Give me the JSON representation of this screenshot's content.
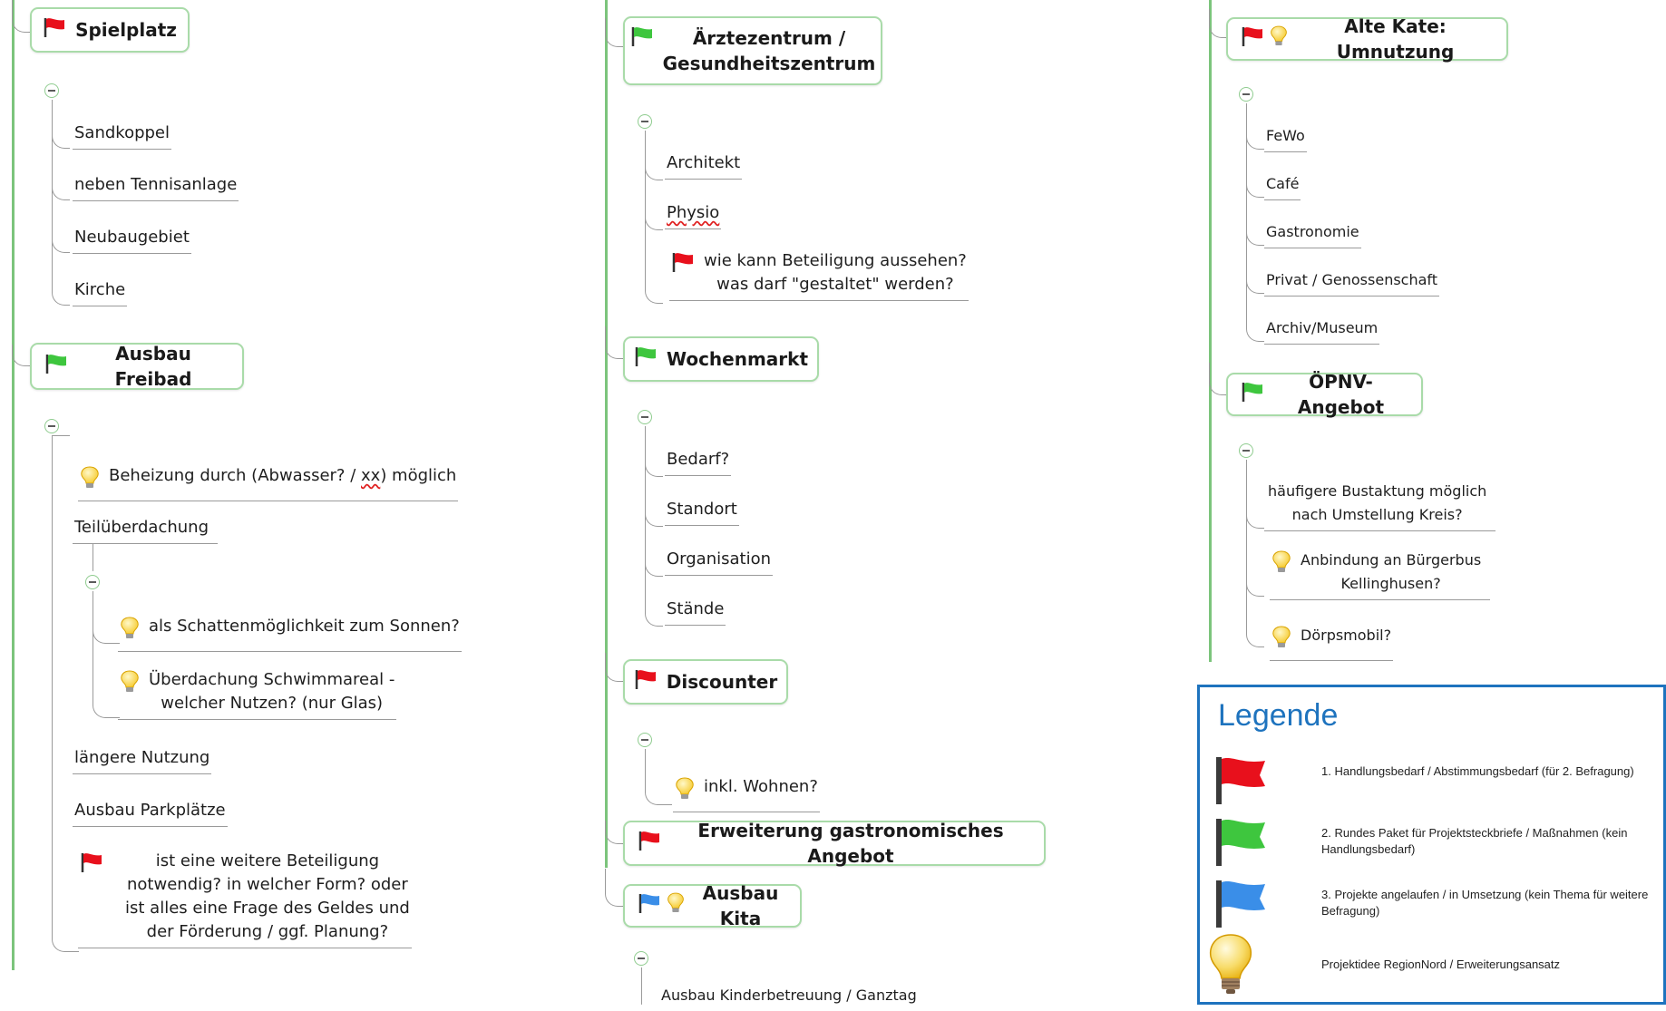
{
  "colors": {
    "red_flag": "#e8101c",
    "green_flag": "#3ec63e",
    "blue_flag": "#3a8ee8",
    "bulb": "#f6c929",
    "trunk": "#7cc47c",
    "topic_border": "#a9dba9",
    "legend_accent": "#1e73be"
  },
  "col1": {
    "spielplatz": {
      "icons": [
        "red-flag-icon"
      ],
      "title": "Spielplatz",
      "items": [
        "Sandkoppel",
        "neben Tennisanlage",
        "Neubaugebiet",
        "Kirche"
      ]
    },
    "freibad": {
      "icons": [
        "green-flag-icon"
      ],
      "title": "Ausbau Freibad",
      "item_heizung_pre": "Beheizung durch (Abwasser? / ",
      "item_heizung_xx": "xx",
      "item_heizung_post": ") möglich",
      "item_teil": "Teilüberdachung",
      "item_schatten": "als Schattenmöglichkeit zum Sonnen?",
      "item_ueber_1": "Überdachung Schwimmareal -",
      "item_ueber_2": "welcher Nutzen? (nur Glas)",
      "item_laenger": "längere Nutzung",
      "item_park": "Ausbau Parkplätze",
      "item_beteil_1": "ist eine weitere Beteiligung",
      "item_beteil_2": "notwendig? in welcher Form? oder",
      "item_beteil_3": "ist alles eine Frage des Geldes und",
      "item_beteil_4": "der Förderung / ggf. Planung?"
    }
  },
  "col2": {
    "arzt": {
      "icons": [
        "green-flag-icon"
      ],
      "title_1": "Ärztezentrum /",
      "title_2": "Gesundheitszentrum",
      "item_arch": "Architekt",
      "item_physio": "Physio",
      "item_wie_1": "wie kann Beteiligung aussehen?",
      "item_wie_2": "was darf \"gestaltet\" werden?"
    },
    "wochenmarkt": {
      "icons": [
        "green-flag-icon"
      ],
      "title": "Wochenmarkt",
      "items": [
        "Bedarf?",
        "Standort",
        "Organisation",
        "Stände"
      ]
    },
    "discounter": {
      "icons": [
        "red-flag-icon"
      ],
      "title": "Discounter",
      "item_wohnen": "inkl. Wohnen?"
    },
    "gastro": {
      "icons": [
        "red-flag-icon"
      ],
      "title": "Erweiterung gastronomisches Angebot"
    },
    "kita": {
      "icons": [
        "blue-flag-icon",
        "bulb-icon"
      ],
      "title": "Ausbau Kita",
      "item_betreuung": "Ausbau Kinderbetreuung / Ganztag"
    }
  },
  "col3": {
    "kate": {
      "icons": [
        "red-flag-icon",
        "bulb-icon"
      ],
      "title": "Alte Kate: Umnutzung",
      "items": [
        "FeWo",
        "Café",
        "Gastronomie",
        "Privat / Genossenschaft",
        "Archiv/Museum"
      ]
    },
    "oepnv": {
      "icons": [
        "green-flag-icon"
      ],
      "title": "ÖPNV-Angebot",
      "item_bus_1": "häufigere Bustaktung möglich",
      "item_bus_2": "nach Umstellung Kreis?",
      "item_anb_1": "Anbindung an Bürgerbus",
      "item_anb_2": "Kellinghusen?",
      "item_doerps": "Dörpsmobil?"
    }
  },
  "legend": {
    "title": "Legende",
    "entries": [
      {
        "icon": "red-flag-icon",
        "text": "1. Handlungsbedarf / Abstimmungsbedarf (für 2. Befragung)"
      },
      {
        "icon": "green-flag-icon",
        "text": "2. Rundes Paket für Projektsteckbriefe / Maßnahmen (kein Handlungsbedarf)"
      },
      {
        "icon": "blue-flag-icon",
        "text": "3. Projekte angelaufen / in Umsetzung (kein Thema für weitere Befragung)"
      },
      {
        "icon": "bulb-icon",
        "text": "Projektidee RegionNord / Erweiterungsansatz"
      }
    ]
  }
}
